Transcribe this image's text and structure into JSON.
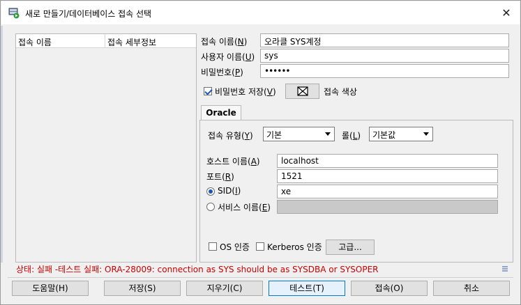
{
  "window": {
    "title": "새로 만들기/데이터베이스 접속 선택",
    "close_glyph": "✕"
  },
  "connection_list": {
    "columns": [
      "접속 이름",
      "접속 세부정보"
    ]
  },
  "form": {
    "conn_name_label": "접속 이름(",
    "conn_name_key": "N",
    "conn_name_value": "오라클 SYS계정",
    "user_label": "사용자 이름(",
    "user_key": "U",
    "user_value": "sys",
    "password_label": "비밀번호(",
    "password_key": "P",
    "password_value": "••••••",
    "save_password_label": "비밀번호 저장(",
    "save_password_key": "V",
    "save_password_checked": true,
    "conn_color_label": "접속 색상"
  },
  "oracle_tab": {
    "tab_label": "Oracle",
    "conn_type_label": "접속 유형(",
    "conn_type_key": "Y",
    "conn_type_value": "기본",
    "role_label": "롤(",
    "role_key": "L",
    "role_value": "기본값",
    "host_label": "호스트 이름(",
    "host_key": "A",
    "host_value": "localhost",
    "port_label": "포트(",
    "port_key": "R",
    "port_value": "1521",
    "sid_label": "SID(",
    "sid_key": "I",
    "sid_value": "xe",
    "sid_selected": true,
    "service_label": "서비스 이름(",
    "service_key": "E",
    "service_value": "",
    "os_auth_label": "OS 인증",
    "kerberos_label": "Kerberos 인증",
    "advanced_label": "고급..."
  },
  "status": {
    "text": "상태: 실패 -테스트 실패: ORA-28009: connection as SYS should be as SYSDBA or SYSOPER",
    "color": "#cc0000"
  },
  "buttons": {
    "help": "도움말(H)",
    "save": "저장(S)",
    "clear": "지우기(C)",
    "test": "테스트(T)",
    "connect": "접속(O)",
    "cancel": "취소"
  }
}
